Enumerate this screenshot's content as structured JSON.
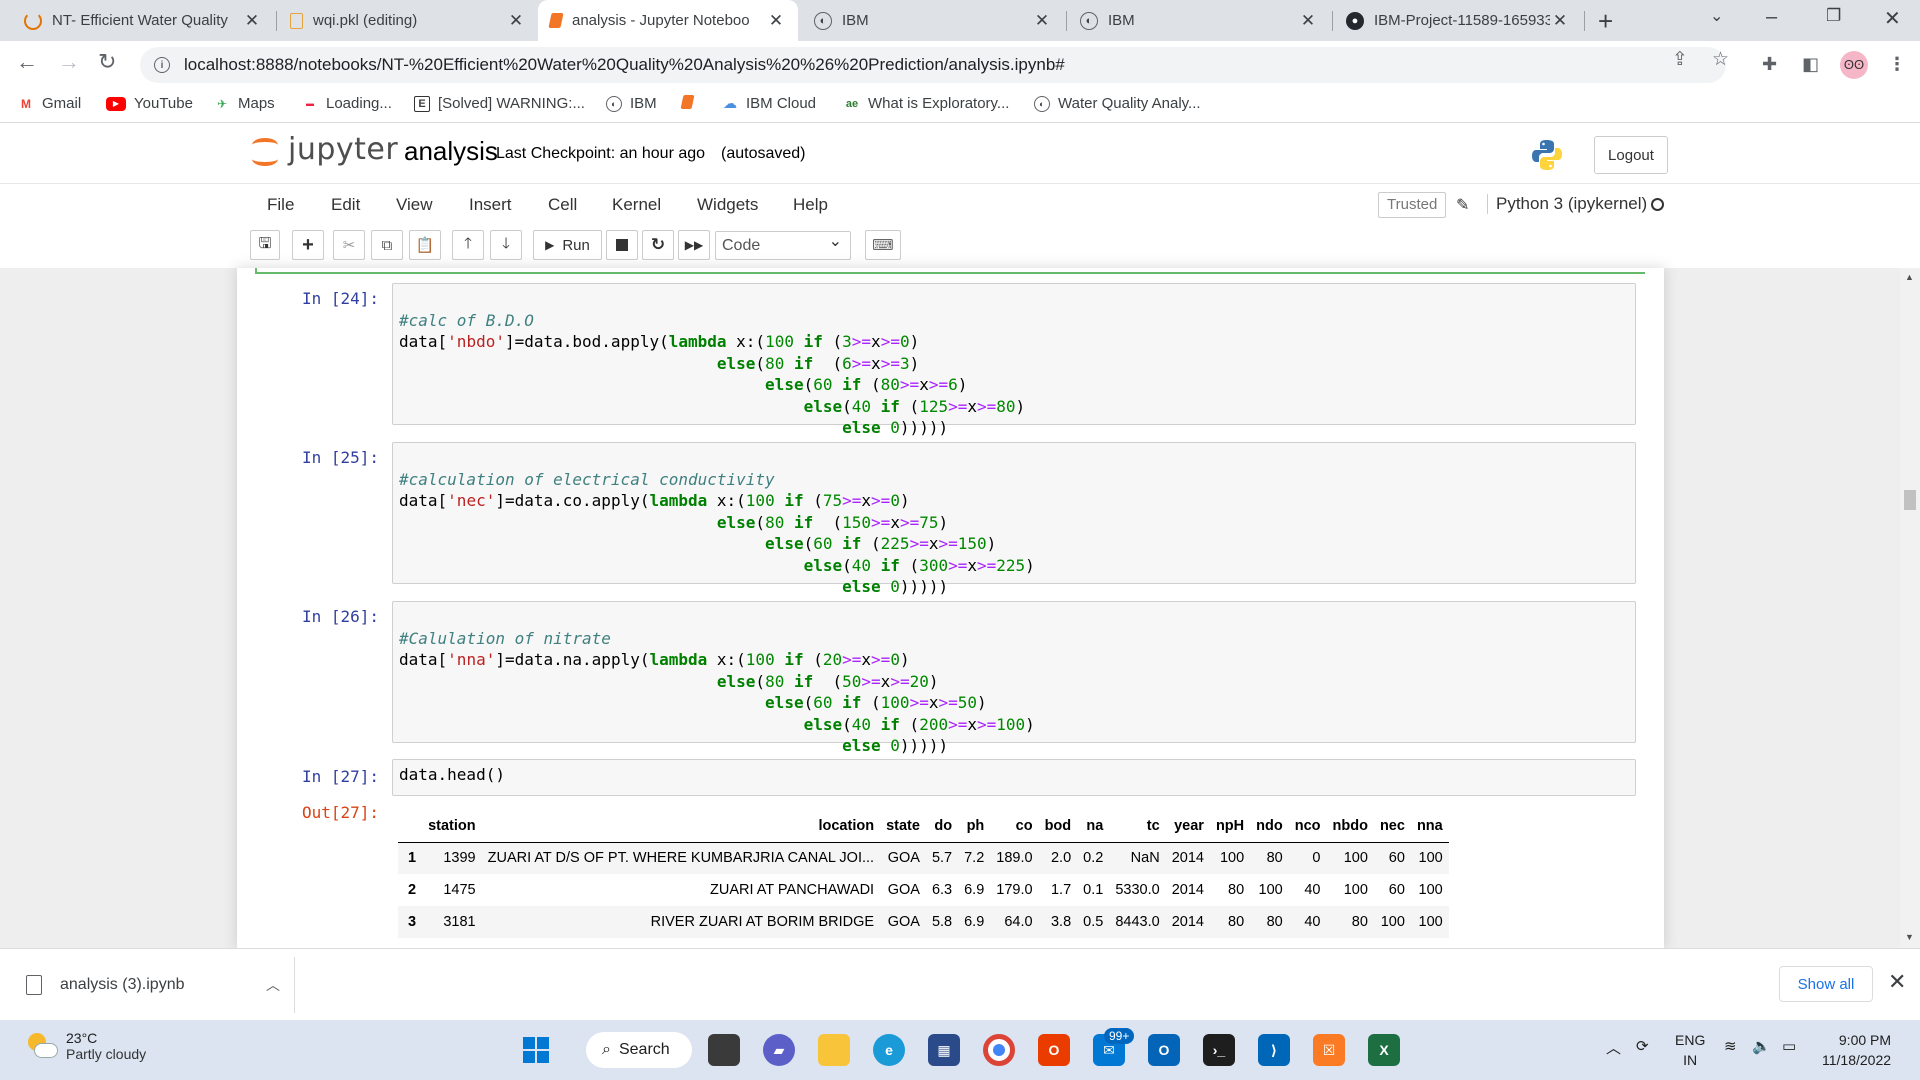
{
  "browser": {
    "tabs": [
      {
        "title": "NT- Efficient Water Quality",
        "active": false
      },
      {
        "title": "wqi.pkl (editing)",
        "active": false
      },
      {
        "title": "analysis - Jupyter Noteboo",
        "active": true
      },
      {
        "title": "IBM",
        "active": false
      },
      {
        "title": "IBM",
        "active": false
      },
      {
        "title": "IBM-Project-11589-165933",
        "active": false
      }
    ],
    "url": "localhost:8888/notebooks/NT-%20Efficient%20Water%20Quality%20Analysis%20%26%20Prediction/analysis.ipynb#",
    "bookmarks": [
      "Gmail",
      "YouTube",
      "Maps",
      "Loading...",
      "[Solved] WARNING:...",
      "IBM",
      "",
      "IBM Cloud",
      "What is Exploratory...",
      "Water Quality Analy..."
    ]
  },
  "jupyter": {
    "logo_text": "jupyter",
    "notebook_name": "analysis",
    "checkpoint": "Last Checkpoint: an hour ago",
    "autosave": "(autosaved)",
    "logout": "Logout",
    "menu": [
      "File",
      "Edit",
      "View",
      "Insert",
      "Cell",
      "Kernel",
      "Widgets",
      "Help"
    ],
    "trusted": "Trusted",
    "kernel": "Python 3 (ipykernel)",
    "run_label": "Run",
    "cell_type": "Code"
  },
  "cells": [
    {
      "prompt": "In [24]:",
      "lines": [
        "#calc of B.D.O",
        "data['nbdo']=data.bod.apply(lambda x:(100 if (3>=x>=0)",
        "                                 else(80 if  (6>=x>=3)",
        "                                      else(60 if (80>=x>=6)",
        "                                          else(40 if (125>=x>=80)",
        "                                              else 0)))))"
      ]
    },
    {
      "prompt": "In [25]:",
      "lines": [
        "#calculation of electrical conductivity",
        "data['nec']=data.co.apply(lambda x:(100 if (75>=x>=0)",
        "                                 else(80 if  (150>=x>=75)",
        "                                      else(60 if (225>=x>=150)",
        "                                          else(40 if (300>=x>=225)",
        "                                              else 0)))))"
      ]
    },
    {
      "prompt": "In [26]:",
      "lines": [
        "#Calulation of nitrate",
        "data['nna']=data.na.apply(lambda x:(100 if (20>=x>=0)",
        "                                 else(80 if  (50>=x>=20)",
        "                                      else(60 if (100>=x>=50)",
        "                                          else(40 if (200>=x>=100)",
        "                                              else 0)))))"
      ]
    },
    {
      "prompt": "In [27]:",
      "lines": [
        "data.head()"
      ]
    }
  ],
  "output": {
    "prompt": "Out[27]:",
    "columns": [
      "",
      "station",
      "location",
      "state",
      "do",
      "ph",
      "co",
      "bod",
      "na",
      "tc",
      "year",
      "npH",
      "ndo",
      "nco",
      "nbdo",
      "nec",
      "nna"
    ],
    "rows": [
      [
        "1",
        "1399",
        "ZUARI AT D/S OF PT. WHERE KUMBARJRIA CANAL JOI...",
        "GOA",
        "5.7",
        "7.2",
        "189.0",
        "2.0",
        "0.2",
        "NaN",
        "2014",
        "100",
        "80",
        "0",
        "100",
        "60",
        "100"
      ],
      [
        "2",
        "1475",
        "ZUARI AT PANCHAWADI",
        "GOA",
        "6.3",
        "6.9",
        "179.0",
        "1.7",
        "0.1",
        "5330.0",
        "2014",
        "80",
        "100",
        "40",
        "100",
        "60",
        "100"
      ],
      [
        "3",
        "3181",
        "RIVER ZUARI AT BORIM BRIDGE",
        "GOA",
        "5.8",
        "6.9",
        "64.0",
        "3.8",
        "0.5",
        "8443.0",
        "2014",
        "80",
        "80",
        "40",
        "80",
        "100",
        "100"
      ]
    ]
  },
  "downloads": {
    "file": "analysis (3).ipynb",
    "show_all": "Show all"
  },
  "taskbar": {
    "temperature": "23°C",
    "weather": "Partly cloudy",
    "search": "Search",
    "badge": "99+",
    "lang_top": "ENG",
    "lang_bottom": "IN",
    "time": "9:00 PM",
    "date": "11/18/2022"
  }
}
